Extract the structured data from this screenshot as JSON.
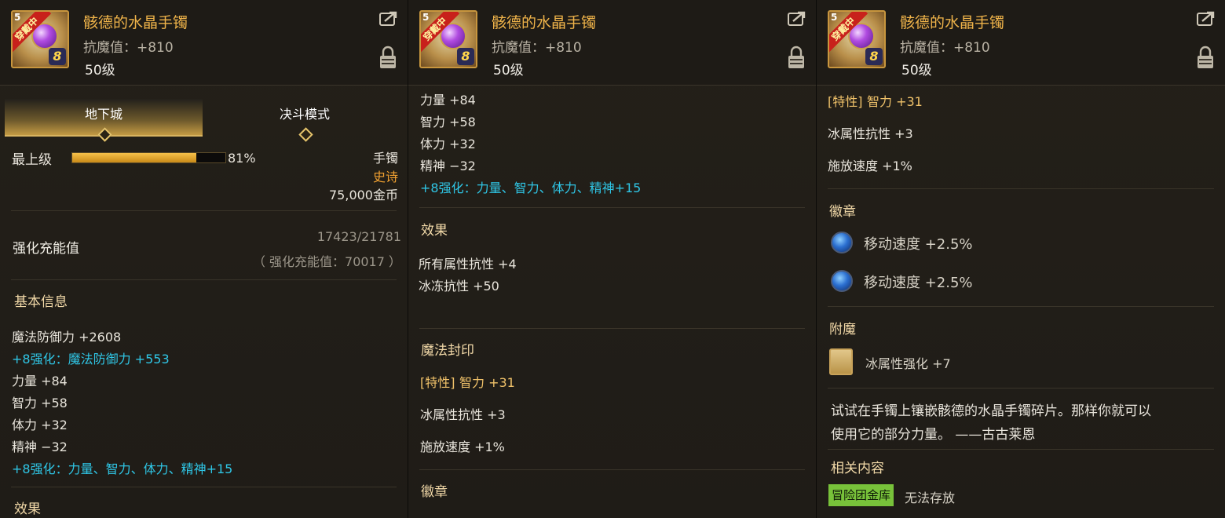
{
  "item": {
    "name": "骸德的水晶手镯",
    "stat": "抗魔值：+810",
    "level": "50级",
    "equipped_badge": "穿戴中",
    "corner_level": "5",
    "enhance": "8"
  },
  "panel1": {
    "tabs": [
      {
        "label": "地下城"
      },
      {
        "label": "决斗模式"
      }
    ],
    "grade": {
      "label": "最上级",
      "percent_text": "81%",
      "percent": 0.81
    },
    "item_type": "手镯",
    "rarity": "史诗",
    "price": "75,000金币",
    "charge": {
      "label": "强化充能值",
      "value": "17423/21781",
      "detail": "（ 强化充能值：70017 ）"
    },
    "basic_title": "基本信息",
    "basic": [
      {
        "text": "魔法防御力 +2608",
        "color": "white"
      },
      {
        "text": "+8强化：魔法防御力 +553",
        "color": "cyan"
      },
      {
        "text": "力量 +84",
        "color": "white"
      },
      {
        "text": "智力 +58",
        "color": "white"
      },
      {
        "text": "体力 +32",
        "color": "white"
      },
      {
        "text": "精神 −32",
        "color": "white"
      },
      {
        "text": "+8强化：力量、智力、体力、精神+15",
        "color": "cyan"
      }
    ],
    "cut_title": "效果"
  },
  "panel2": {
    "stats": [
      {
        "text": "力量 +84",
        "color": "white"
      },
      {
        "text": "智力 +58",
        "color": "white"
      },
      {
        "text": "体力 +32",
        "color": "white"
      },
      {
        "text": "精神 −32",
        "color": "white"
      },
      {
        "text": "+8强化：力量、智力、体力、精神+15",
        "color": "cyan"
      }
    ],
    "effect_title": "效果",
    "effects": [
      "所有属性抗性 +4",
      "冰冻抗性 +50"
    ],
    "seal_title": "魔法封印",
    "seals": [
      {
        "prefix": "[特性]",
        "text": "智力 +31"
      },
      {
        "prefix": "",
        "text": "冰属性抗性 +3"
      },
      {
        "prefix": "",
        "text": "施放速度 +1%"
      }
    ],
    "emblem_title": "徽章"
  },
  "panel3": {
    "seals": [
      {
        "prefix": "[特性]",
        "text": "智力 +31"
      },
      {
        "prefix": "",
        "text": "冰属性抗性 +3"
      },
      {
        "prefix": "",
        "text": "施放速度 +1%"
      }
    ],
    "emblem_title": "徽章",
    "emblems": [
      "移动速度 +2.5%",
      "移动速度 +2.5%"
    ],
    "enchant_title": "附魔",
    "enchant": "冰属性强化 +7",
    "flavor_line1": "试试在手镯上镶嵌骸德的水晶手镯碎片。那样你就可以",
    "flavor_line2": "使用它的部分力量。 ——古古莱恩",
    "related_title": "相关内容",
    "related_tag": "冒险团金库",
    "related_text": "无法存放"
  }
}
